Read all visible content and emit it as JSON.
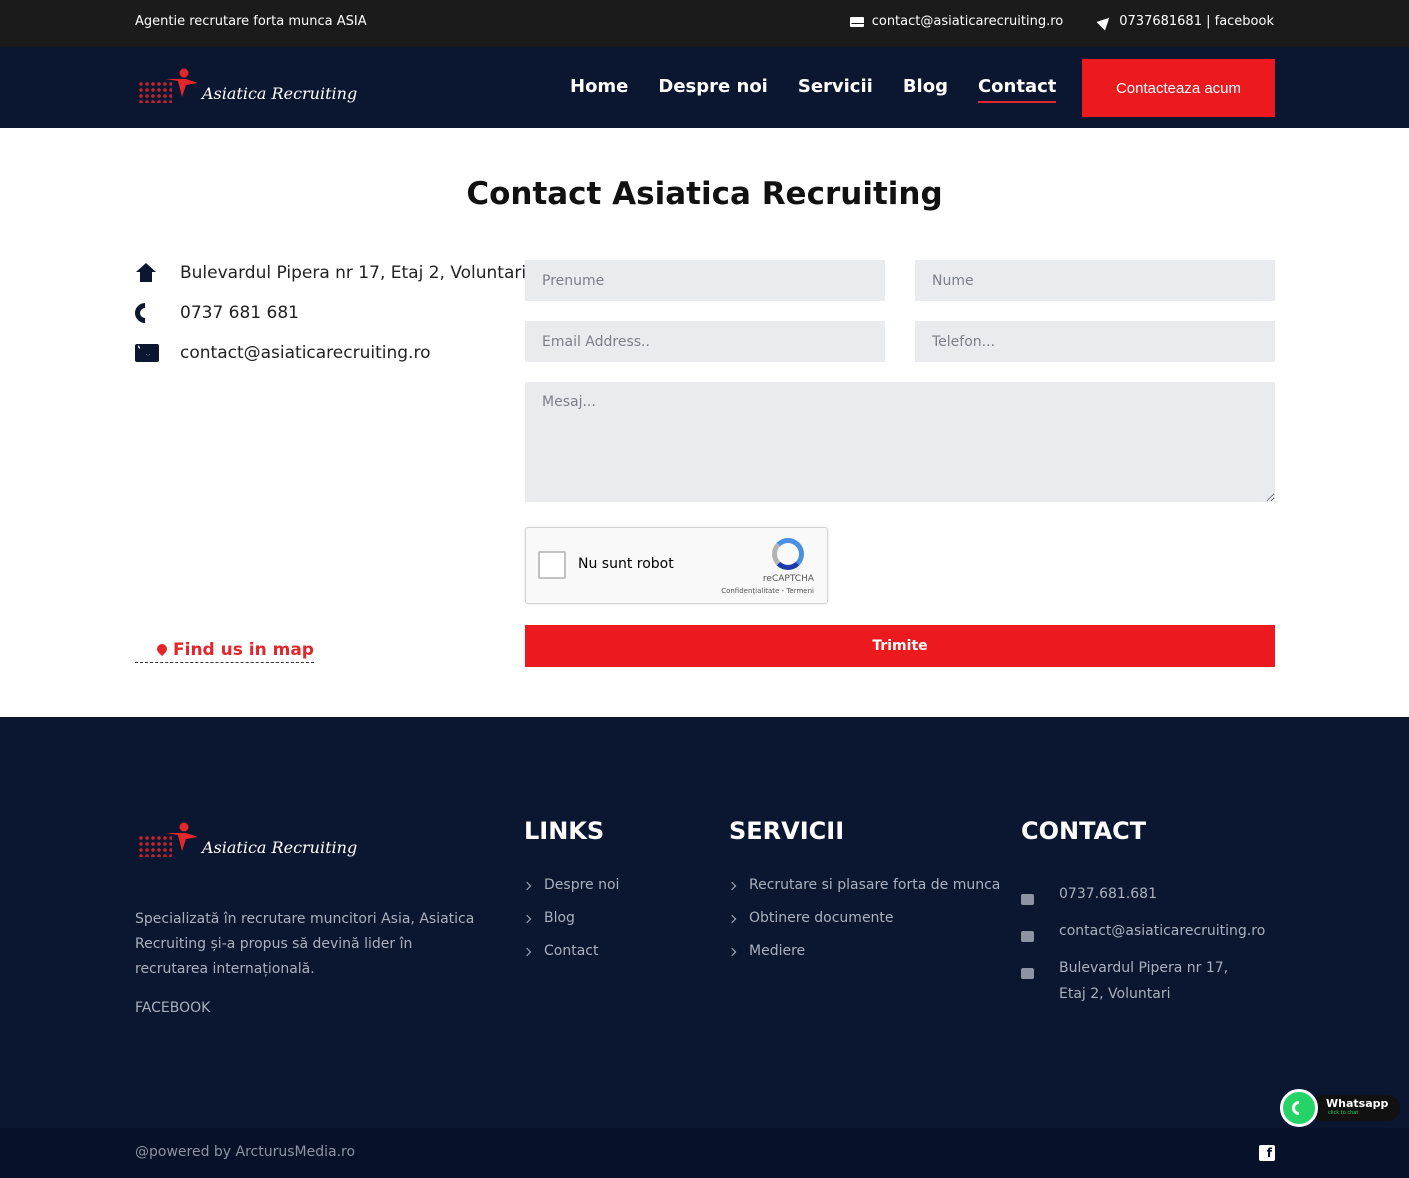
{
  "topbar": {
    "tagline": "Agentie recrutare forta munca ASIA",
    "email": "contact@asiaticarecruiting.ro",
    "phone_social": "0737681681 | facebook"
  },
  "brand": {
    "logo_text": "Asiatica Recruiting"
  },
  "nav": {
    "items": [
      {
        "label": "Home"
      },
      {
        "label": "Despre noi"
      },
      {
        "label": "Servicii"
      },
      {
        "label": "Blog"
      },
      {
        "label": "Contact",
        "active": true
      }
    ],
    "cta_label": "Contacteaza acum"
  },
  "page": {
    "title": "Contact Asiatica Recruiting"
  },
  "info": {
    "address": "Bulevardul Pipera nr 17, Etaj 2, Voluntari",
    "phone": "0737 681 681",
    "email": "contact@asiaticarecruiting.ro",
    "map_link": "Find us in map"
  },
  "form": {
    "first_name_placeholder": "Prenume",
    "last_name_placeholder": "Nume",
    "email_placeholder": "Email Address..",
    "phone_placeholder": "Telefon...",
    "message_placeholder": "Mesaj...",
    "captcha_label": "Nu sunt robot",
    "captcha_brand": "reCAPTCHA",
    "captcha_terms": "Confidențialitate - Termeni",
    "submit_label": "Trimite"
  },
  "footer": {
    "about": "Specializată în recrutare muncitori Asia, Asiatica Recruiting și-a propus să devină lider în recrutarea internațională.",
    "facebook": "FACEBOOK",
    "links": {
      "title": "LINKS",
      "items": [
        "Despre noi",
        "Blog",
        "Contact"
      ]
    },
    "services": {
      "title": "SERVICII",
      "items": [
        "Recrutare si plasare forta de munca",
        "Obtinere documente",
        "Mediere"
      ]
    },
    "contact": {
      "title": "CONTACT",
      "phone": "0737.681.681",
      "email": "contact@asiaticarecruiting.ro",
      "address": "Bulevardul Pipera nr 17, Etaj 2, Voluntari"
    },
    "powered": "@powered by ArcturusMedia.ro"
  },
  "whatsapp": {
    "label": "Whatsapp",
    "sub": "click to chat"
  },
  "colors": {
    "navy": "#0b1630",
    "red": "#ec1a1f",
    "field": "#e9ebef"
  }
}
